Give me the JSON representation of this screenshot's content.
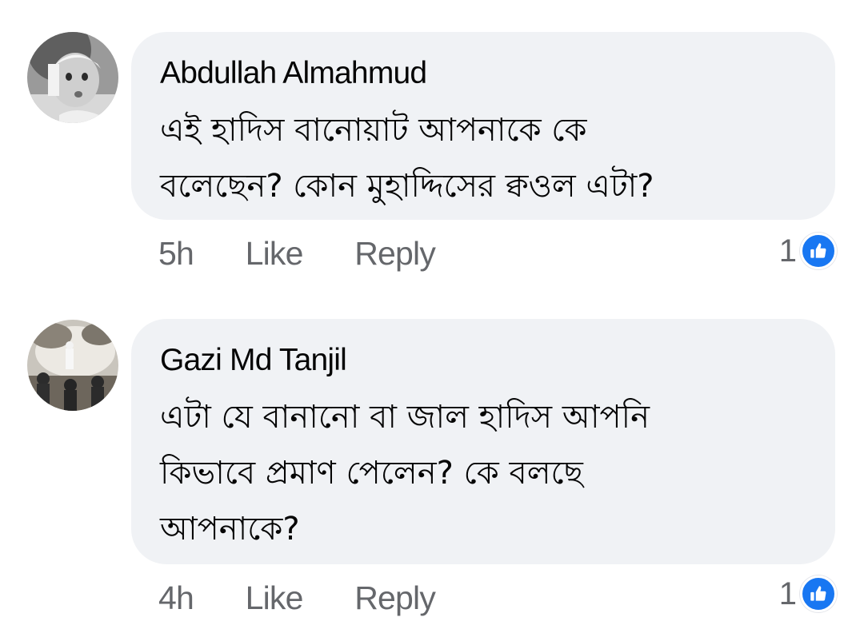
{
  "comments": [
    {
      "author": "Abdullah Almahmud",
      "text_lines": [
        "এই হাদিস বানোয়াট আপনাকে কে",
        "বলেছেন? কোন মুহাদ্দিসের ক্বওল এটা?"
      ],
      "time": "5h",
      "like_label": "Like",
      "reply_label": "Reply",
      "reaction_count": "1",
      "reaction_icon": "like-thumb-icon"
    },
    {
      "author": "Gazi Md Tanjil",
      "text_lines": [
        "এটা যে বানানো বা জাল হাদিস আপনি",
        "কিভাবে প্রমাণ পেলেন? কে বলছে",
        "আপনাকে?"
      ],
      "time": "4h",
      "like_label": "Like",
      "reply_label": "Reply",
      "reaction_count": "1",
      "reaction_icon": "like-thumb-icon"
    }
  ],
  "colors": {
    "bubble_bg": "#f0f2f5",
    "text": "#050505",
    "secondary_text": "#65676b",
    "like_blue": "#1877f2"
  }
}
